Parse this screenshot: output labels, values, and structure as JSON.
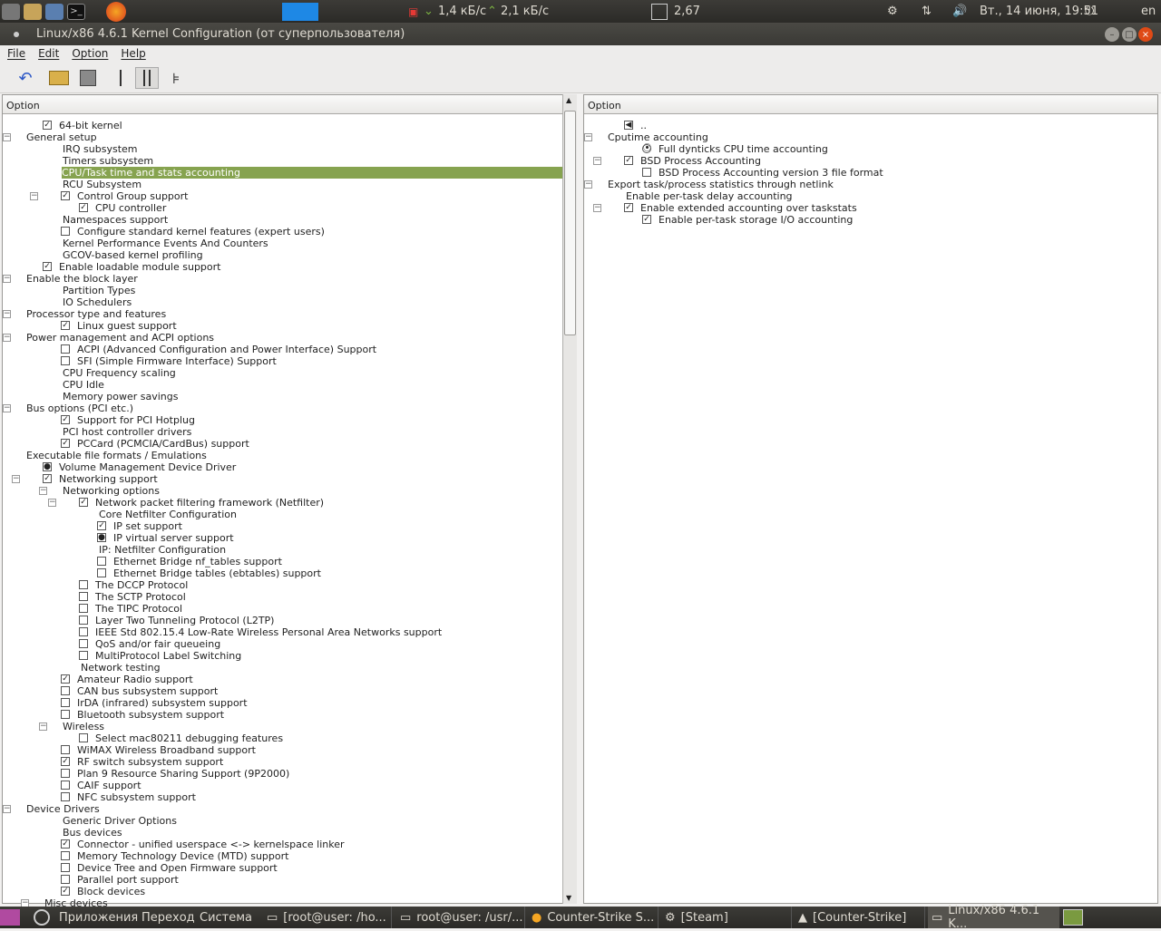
{
  "topbar": {
    "net_down": "1,4 кБ/с",
    "net_up": "2,1 кБ/с",
    "cpu_load": "2,67",
    "datetime": "Вт., 14 июня, 19:51",
    "lang": "en"
  },
  "window": {
    "title": "Linux/x86 4.6.1 Kernel Configuration (от суперпользователя)"
  },
  "menu": {
    "file": "File",
    "edit": "Edit",
    "option": "Option",
    "help": "Help"
  },
  "left_header": "Option",
  "right_header": "Option",
  "left_rows": [
    {
      "label": "64-bit kernel",
      "level": 1,
      "cb": "checked"
    },
    {
      "label": "General setup",
      "level": 0,
      "exp": "minus"
    },
    {
      "label": "IRQ subsystem",
      "level": 2
    },
    {
      "label": "Timers subsystem",
      "level": 2
    },
    {
      "label": "CPU/Task time and stats accounting",
      "level": 2,
      "selected": true
    },
    {
      "label": "RCU Subsystem",
      "level": 2
    },
    {
      "label": "Control Group support",
      "level": 2,
      "cb": "checked",
      "exp": "minus"
    },
    {
      "label": "CPU controller",
      "level": 3,
      "cb": "checked"
    },
    {
      "label": "Namespaces support",
      "level": 2
    },
    {
      "label": "Configure standard kernel features (expert users)",
      "level": 2,
      "cb": "empty"
    },
    {
      "label": "Kernel Performance Events And Counters",
      "level": 2
    },
    {
      "label": "GCOV-based kernel profiling",
      "level": 2
    },
    {
      "label": "Enable loadable module support",
      "level": 1,
      "cb": "checked"
    },
    {
      "label": "Enable the block layer",
      "level": 0,
      "exp": "minus"
    },
    {
      "label": "Partition Types",
      "level": 2
    },
    {
      "label": "IO Schedulers",
      "level": 2
    },
    {
      "label": "Processor type and features",
      "level": 0,
      "exp": "minus"
    },
    {
      "label": "Linux guest support",
      "level": 2,
      "cb": "checked"
    },
    {
      "label": "Power management and ACPI options",
      "level": 0,
      "exp": "minus"
    },
    {
      "label": "ACPI (Advanced Configuration and Power Interface) Support",
      "level": 2,
      "cb": "empty"
    },
    {
      "label": "SFI (Simple Firmware Interface) Support",
      "level": 2,
      "cb": "empty"
    },
    {
      "label": "CPU Frequency scaling",
      "level": 2
    },
    {
      "label": "CPU Idle",
      "level": 2
    },
    {
      "label": "Memory power savings",
      "level": 2
    },
    {
      "label": "Bus options (PCI etc.)",
      "level": 0,
      "exp": "minus"
    },
    {
      "label": "Support for PCI Hotplug",
      "level": 2,
      "cb": "checked"
    },
    {
      "label": "PCI host controller drivers",
      "level": 2
    },
    {
      "label": "PCCard (PCMCIA/CardBus) support",
      "level": 2,
      "cb": "checked"
    },
    {
      "label": "Executable file formats / Emulations",
      "level": 0
    },
    {
      "label": "Volume Management Device Driver",
      "level": 1,
      "cb": "module"
    },
    {
      "label": "Networking support",
      "level": 1,
      "cb": "checked",
      "exp": "minus"
    },
    {
      "label": "Networking options",
      "level": 2,
      "exp": "minus"
    },
    {
      "label": "Network packet filtering framework (Netfilter)",
      "level": 3,
      "cb": "checked",
      "exp": "minus"
    },
    {
      "label": "Core Netfilter Configuration",
      "level": 4
    },
    {
      "label": "IP set support",
      "level": 4,
      "cb": "checked"
    },
    {
      "label": "IP virtual server support",
      "level": 4,
      "cb": "module"
    },
    {
      "label": "IP: Netfilter Configuration",
      "level": 4
    },
    {
      "label": "Ethernet Bridge nf_tables support",
      "level": 4,
      "cb": "empty"
    },
    {
      "label": "Ethernet Bridge tables (ebtables) support",
      "level": 4,
      "cb": "empty"
    },
    {
      "label": "The DCCP Protocol",
      "level": 3,
      "cb": "empty"
    },
    {
      "label": "The SCTP Protocol",
      "level": 3,
      "cb": "empty"
    },
    {
      "label": "The TIPC Protocol",
      "level": 3,
      "cb": "empty"
    },
    {
      "label": "Layer Two Tunneling Protocol (L2TP)",
      "level": 3,
      "cb": "empty"
    },
    {
      "label": "IEEE Std 802.15.4 Low-Rate Wireless Personal Area Networks support",
      "level": 3,
      "cb": "empty"
    },
    {
      "label": "QoS and/or fair queueing",
      "level": 3,
      "cb": "empty"
    },
    {
      "label": "MultiProtocol Label Switching",
      "level": 3,
      "cb": "empty"
    },
    {
      "label": "Network testing",
      "level": 3
    },
    {
      "label": "Amateur Radio support",
      "level": 2,
      "cb": "checked"
    },
    {
      "label": "CAN bus subsystem support",
      "level": 2,
      "cb": "empty"
    },
    {
      "label": "IrDA (infrared) subsystem support",
      "level": 2,
      "cb": "empty"
    },
    {
      "label": "Bluetooth subsystem support",
      "level": 2,
      "cb": "empty"
    },
    {
      "label": "Wireless",
      "level": 2,
      "exp": "minus"
    },
    {
      "label": "Select mac80211 debugging features",
      "level": 3,
      "cb": "empty"
    },
    {
      "label": "WiMAX Wireless Broadband support",
      "level": 2,
      "cb": "empty"
    },
    {
      "label": "RF switch subsystem support",
      "level": 2,
      "cb": "checked"
    },
    {
      "label": "Plan 9 Resource Sharing Support (9P2000)",
      "level": 2,
      "cb": "empty"
    },
    {
      "label": "CAIF support",
      "level": 2,
      "cb": "empty"
    },
    {
      "label": "NFC subsystem support",
      "level": 2,
      "cb": "empty"
    },
    {
      "label": "Device Drivers",
      "level": 0,
      "exp": "minus"
    },
    {
      "label": "Generic Driver Options",
      "level": 2
    },
    {
      "label": "Bus devices",
      "level": 2
    },
    {
      "label": "Connector - unified userspace <-> kernelspace linker",
      "level": 2,
      "cb": "checked"
    },
    {
      "label": "Memory Technology Device (MTD) support",
      "level": 2,
      "cb": "empty"
    },
    {
      "label": "Device Tree and Open Firmware support",
      "level": 2,
      "cb": "empty"
    },
    {
      "label": "Parallel port support",
      "level": 2,
      "cb": "empty"
    },
    {
      "label": "Block devices",
      "level": 2,
      "cb": "checked"
    },
    {
      "label": "Misc devices",
      "level": 1,
      "exp": "minus"
    }
  ],
  "right_rows": [
    {
      "label": "..",
      "level": 1,
      "cb": "back"
    },
    {
      "label": "Cputime accounting",
      "level": 0,
      "exp": "minus"
    },
    {
      "label": "Full dynticks CPU time accounting",
      "level": 2,
      "cb": "radio"
    },
    {
      "label": "BSD Process Accounting",
      "level": 1,
      "cb": "checked",
      "exp": "minus"
    },
    {
      "label": "BSD Process Accounting version 3 file format",
      "level": 2,
      "cb": "empty"
    },
    {
      "label": "Export task/process statistics through netlink",
      "level": 0,
      "exp": "minus"
    },
    {
      "label": "Enable per-task delay accounting",
      "level": 1
    },
    {
      "label": "Enable extended accounting over taskstats",
      "level": 1,
      "cb": "checked",
      "exp": "minus"
    },
    {
      "label": "Enable per-task storage I/O accounting",
      "level": 2,
      "cb": "checked"
    }
  ],
  "taskbar": {
    "apps": "Приложения",
    "places": "Переход",
    "system": "Система",
    "t1": "[root@user: /ho...",
    "t2": "root@user: /usr/...",
    "t3": "Counter-Strike S...",
    "t4": "[Steam]",
    "t5": "[Counter-Strike]",
    "t6": "Linux/x86 4.6.1 K..."
  }
}
